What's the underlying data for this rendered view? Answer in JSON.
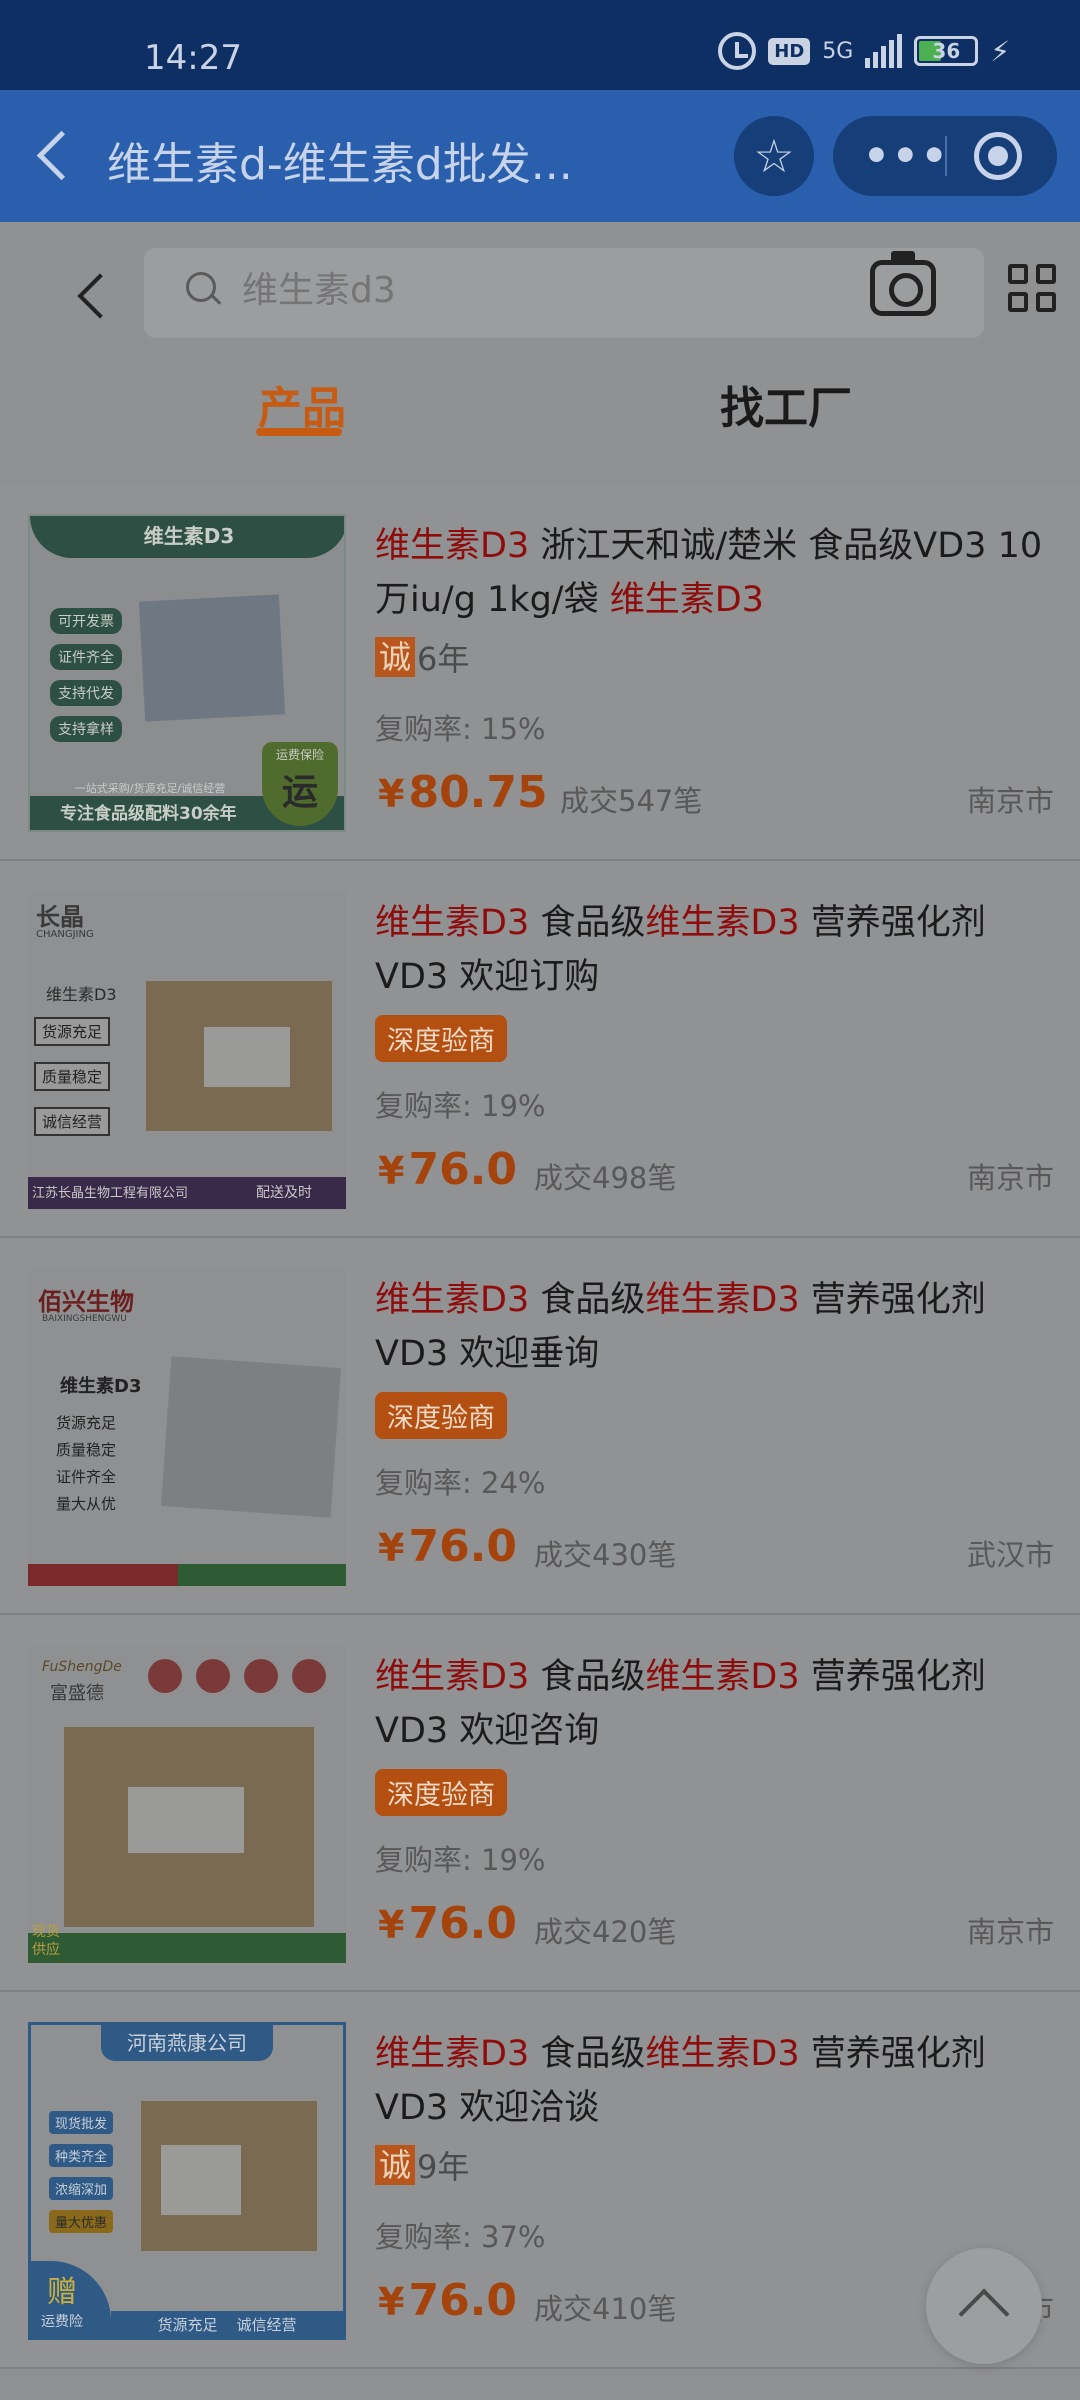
{
  "status": {
    "time": "14:27",
    "network": "5G",
    "hd": "HD",
    "battery": "36"
  },
  "titlebar": {
    "title": "维生素d-维生素d批发..."
  },
  "search": {
    "placeholder": "维生素d3"
  },
  "tabs": [
    {
      "label": "产品",
      "active": true
    },
    {
      "label": "找工厂",
      "active": false
    }
  ],
  "colors": {
    "accent": "#c75b12",
    "highlight": "#8e0c0c",
    "titlebar": "#2a5fae",
    "statusbar": "#0e2f63"
  },
  "products": [
    {
      "title_parts": [
        "维生素D3",
        " 浙江天和诚/楚米 食品级VD3 10万iu/g 1kg/袋 ",
        "维生素D3",
        ""
      ],
      "badge_type": "cheng",
      "badge_icon": "诚",
      "badge_text": "6年",
      "repurchase": "复购率: 15%",
      "price_symbol": "¥",
      "price": "80.75",
      "deals": "成交547笔",
      "city": "南京市",
      "thumb": {
        "title": "维生素D3",
        "tags": [
          "可开发票",
          "证件齐全",
          "支持代发",
          "支持拿样"
        ],
        "banner": "一站式采购/货源充足/诚信经营",
        "footer": "专注食品级配料30余年",
        "seal_top": "运费保险",
        "seal": "运"
      }
    },
    {
      "title_parts": [
        "维生素D3",
        " 食品级",
        "维生素D3",
        " 营养强化剂 VD3 欢迎订购"
      ],
      "badge_type": "merchant",
      "badge_text": "深度验商",
      "repurchase": "复购率: 19%",
      "price_symbol": "¥",
      "price": "76.0",
      "deals": "成交498笔",
      "city": "南京市",
      "thumb": {
        "logo": "长晶",
        "logo_sub": "CHANGJING",
        "title": "维生素D3",
        "tags": [
          "货源充足",
          "质量稳定",
          "诚信经营"
        ],
        "footer_left": "江苏长晶生物工程有限公司",
        "footer_right": "配送及时"
      }
    },
    {
      "title_parts": [
        "维生素D3",
        " 食品级",
        "维生素D3",
        " 营养强化剂 VD3 欢迎垂询"
      ],
      "badge_type": "merchant",
      "badge_text": "深度验商",
      "repurchase": "复购率: 24%",
      "price_symbol": "¥",
      "price": "76.0",
      "deals": "成交430笔",
      "city": "武汉市",
      "thumb": {
        "logo": "佰兴生物",
        "logo_sub": "BAIXINGSHENGWU",
        "title": "维生素D3",
        "tags": [
          "货源充足",
          "质量稳定",
          "证件齐全",
          "量大从优"
        ]
      }
    },
    {
      "title_parts": [
        "维生素D3",
        " 食品级",
        "维生素D3",
        " 营养强化剂 VD3 欢迎咨询"
      ],
      "badge_type": "merchant",
      "badge_text": "深度验商",
      "repurchase": "复购率: 19%",
      "price_symbol": "¥",
      "price": "76.0",
      "deals": "成交420笔",
      "city": "南京市",
      "thumb": {
        "logo": "富盛德",
        "logo_sub": "FuShengDe",
        "footer_left": "现货 供应"
      }
    },
    {
      "title_parts": [
        "维生素D3",
        " 食品级",
        "维生素D3",
        " 营养强化剂 VD3 欢迎洽谈"
      ],
      "badge_type": "cheng",
      "badge_icon": "诚",
      "badge_text": "9年",
      "repurchase": "复购率: 37%",
      "price_symbol": "¥",
      "price": "76.0",
      "deals": "成交410笔",
      "city": "南京市",
      "thumb": {
        "header": "河南燕康公司",
        "tags": [
          "现货批发",
          "种类齐全",
          "浓缩深加",
          "量大优惠"
        ],
        "gift": "赠",
        "gift_sub": "运费险",
        "footer": "货源充足    诚信经营"
      }
    }
  ]
}
